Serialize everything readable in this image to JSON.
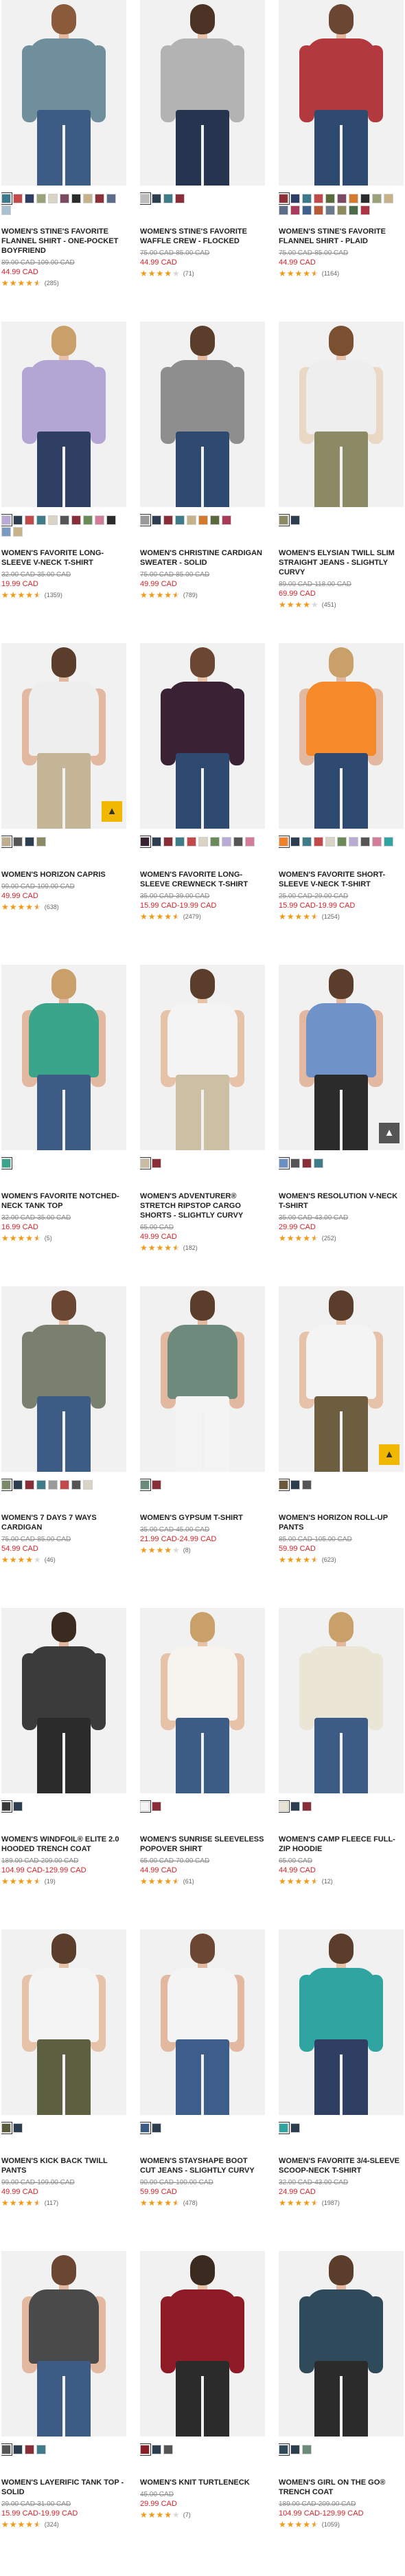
{
  "colors": {
    "sale_red": "#d5232a",
    "star_orange": "#f29b12",
    "strike_gray": "#8a8a8a",
    "badge_yellow": "#f2b800"
  },
  "products": [
    {
      "name": "Women's Stine's Favorite Flannel Shirt - One-Pocket Boyfriend",
      "price_original": "89.00 CAD-109.00 CAD",
      "price_sale": "44.99 CAD",
      "rating": 4.5,
      "reviews": "(285)",
      "swatches": [
        "#3b7a8c",
        "#c24a4a",
        "#2f3e63",
        "#9aa27a",
        "#d9d4c6",
        "#7a4b63",
        "#2b2b2b",
        "#c7b38a",
        "#8c2f39",
        "#5c6d8a",
        "#a9c1cf"
      ],
      "look": {
        "skin": "#e2b9a0",
        "hair": "#8a5a3a",
        "top": "#6f8f9c",
        "sleeve": "#6f8f9c",
        "legs": "#3c5b85"
      }
    },
    {
      "name": "Women's Stine's Favorite Waffle Crew - Flocked",
      "price_original": "75.00 CAD-85.00 CAD",
      "price_sale": "44.99 CAD",
      "rating": 4.0,
      "reviews": "(71)",
      "swatches": [
        "#bcbcbc",
        "#2c3e50",
        "#3f7c8a",
        "#8a2f3a"
      ],
      "look": {
        "skin": "#e6c2a8",
        "hair": "#4a3325",
        "top": "#b3b3b3",
        "sleeve": "#b3b3b3",
        "legs": "#26344f"
      }
    },
    {
      "name": "Women's Stine's Favorite Flannel Shirt - Plaid",
      "price_original": "75.00 CAD-85.00 CAD",
      "price_sale": "44.99 CAD",
      "rating": 4.5,
      "reviews": "(1164)",
      "swatches": [
        "#8c2f39",
        "#2f3e63",
        "#3b7a8c",
        "#c24a4a",
        "#5a6b3b",
        "#7a4b63",
        "#d47a2b",
        "#2b2b2b",
        "#9aa27a",
        "#c7b38a",
        "#5c6d8a",
        "#a83a5a",
        "#3f5f8f",
        "#b85a3a",
        "#6a7a8a",
        "#8a8a5a",
        "#4a6a4a",
        "#aa3344"
      ],
      "look": {
        "skin": "#e2b9a0",
        "hair": "#6b4632",
        "top": "#b23a3f",
        "sleeve": "#b23a3f",
        "legs": "#2f4a70"
      }
    },
    {
      "name": "Women's Favorite Long-Sleeve V-Neck T-Shirt",
      "price_original": "32.00 CAD-35.00 CAD",
      "price_sale": "19.99 CAD",
      "rating": 4.5,
      "reviews": "(1359)",
      "swatches": [
        "#b9aad6",
        "#2c3e50",
        "#c24a4a",
        "#3f7c8a",
        "#d9d4c6",
        "#555555",
        "#8a2f3a",
        "#6a8a5a",
        "#d47a9a",
        "#2b2b2b",
        "#7a9ac4",
        "#c7b38a"
      ],
      "look": {
        "skin": "#e6c2a8",
        "hair": "#c9a06a",
        "top": "#b3a6d4",
        "sleeve": "#b3a6d4",
        "legs": "#2f3e63"
      }
    },
    {
      "name": "Women's Christine Cardigan Sweater - Solid",
      "price_original": "75.00 CAD-85.00 CAD",
      "price_sale": "49.99 CAD",
      "rating": 4.5,
      "reviews": "(789)",
      "swatches": [
        "#9a9a9a",
        "#2c3e50",
        "#8a2f3a",
        "#3f7c8a",
        "#c7b38a",
        "#d47a2b",
        "#5a6b3b",
        "#a83a5a"
      ],
      "look": {
        "skin": "#e2b9a0",
        "hair": "#5a3d2a",
        "top": "#8e8e8e",
        "sleeve": "#8e8e8e",
        "legs": "#2f4a70"
      }
    },
    {
      "name": "Women's Elysian Twill Slim Straight Jeans - Slightly Curvy",
      "price_original": "89.00 CAD-118.00 CAD",
      "price_sale": "69.99 CAD",
      "rating": 4.0,
      "reviews": "(451)",
      "swatches": [
        "#8c8a64",
        "#2c3e50"
      ],
      "look": {
        "skin": "#e6c2a8",
        "hair": "#7a5030",
        "top": "#eeeeee",
        "sleeve": "#e8d8c4",
        "legs": "#8c8a64"
      }
    },
    {
      "name": "Women's Horizon Capris",
      "price_original": "99.00 CAD-109.00 CAD",
      "price_sale": "49.99 CAD",
      "rating": 4.5,
      "reviews": "(638)",
      "swatches": [
        "#bfae8e",
        "#555555",
        "#2c3e50",
        "#8c8a64"
      ],
      "look": {
        "skin": "#e2b9a0",
        "hair": "#5a3d2a",
        "top": "#eeeeee",
        "sleeve": "#e2b9a0",
        "legs": "#c4b596"
      }
    },
    {
      "name": "Women's Favorite Long-Sleeve Crewneck T-Shirt",
      "price_original": "35.00 CAD-39.00 CAD",
      "price_sale": "15.99 CAD-19.99 CAD",
      "rating": 4.5,
      "reviews": "(2479)",
      "swatches": [
        "#3a2235",
        "#2c3e50",
        "#8a2f3a",
        "#3f7c8a",
        "#c24a4a",
        "#d9d4c6",
        "#6a8a5a",
        "#b9aad6",
        "#555555",
        "#d47a9a"
      ],
      "look": {
        "skin": "#e6c2a8",
        "hair": "#6b4632",
        "top": "#3a2235",
        "sleeve": "#3a2235",
        "legs": "#2f4a70"
      }
    },
    {
      "name": "Women's Favorite Short-Sleeve V-Neck T-Shirt",
      "price_original": "25.00 CAD-29.00 CAD",
      "price_sale": "15.99 CAD-19.99 CAD",
      "rating": 4.5,
      "reviews": "(1254)",
      "swatches": [
        "#f2822a",
        "#2c3e50",
        "#3f7c8a",
        "#c24a4a",
        "#d9d4c6",
        "#6a8a5a",
        "#b9aad6",
        "#555555",
        "#d47a9a",
        "#2fa4a0"
      ],
      "look": {
        "skin": "#e2b9a0",
        "hair": "#c9a06a",
        "top": "#f68a2a",
        "sleeve": "#e2b9a0",
        "legs": "#2f4a70"
      }
    },
    {
      "name": "Women's Favorite Notched-Neck Tank Top",
      "price_original": "32.00 CAD-35.00 CAD",
      "price_sale": "16.99 CAD",
      "rating": 4.5,
      "reviews": "(5)",
      "swatches": [
        "#3aa58a"
      ],
      "look": {
        "skin": "#e2b9a0",
        "hair": "#c9a06a",
        "top": "#3aa58a",
        "sleeve": "#e2b9a0",
        "legs": "#3c5b85"
      }
    },
    {
      "name": "Women's Adventurer® Stretch Ripstop Cargo Shorts - Slightly Curvy",
      "price_original": "65.00 CAD",
      "price_sale": "49.99 CAD",
      "rating": 4.5,
      "reviews": "(182)",
      "swatches": [
        "#c9bca2",
        "#8a2f3a"
      ],
      "look": {
        "skin": "#e6c2a8",
        "hair": "#5a3d2a",
        "top": "#f4f4f4",
        "sleeve": "#e6c2a8",
        "legs": "#cdbfa4"
      }
    },
    {
      "name": "Women's Resolution V-Neck T-Shirt",
      "price_original": "35.00 CAD-43.00 CAD",
      "price_sale": "29.99 CAD",
      "rating": 4.5,
      "reviews": "(252)",
      "swatches": [
        "#6a8fc4",
        "#555555",
        "#8a2f3a",
        "#3f7c8a"
      ],
      "look": {
        "skin": "#e2b9a0",
        "hair": "#5a3d2a",
        "top": "#6f93c8",
        "sleeve": "#e2b9a0",
        "legs": "#2b2b2b"
      }
    },
    {
      "name": "Women's 7 Days 7 Ways Cardigan",
      "price_original": "75.00 CAD-85.00 CAD",
      "price_sale": "54.99 CAD",
      "rating": 4.0,
      "reviews": "(46)",
      "swatches": [
        "#7a8a6a",
        "#2c3e50",
        "#8a2f3a",
        "#3f7c8a",
        "#9a9a9a",
        "#c24a4a",
        "#555555",
        "#d9d4c6"
      ],
      "look": {
        "skin": "#e6c2a8",
        "hair": "#6b4632",
        "top": "#7a8070",
        "sleeve": "#7a8070",
        "legs": "#3c5b85"
      }
    },
    {
      "name": "Women's Gypsum T-Shirt",
      "price_original": "35.00 CAD-45.00 CAD",
      "price_sale": "21.99 CAD-24.99 CAD",
      "rating": 4.0,
      "reviews": "(8)",
      "swatches": [
        "#6a8a7a",
        "#8a2f3a"
      ],
      "look": {
        "skin": "#e2b9a0",
        "hair": "#5a3d2a",
        "top": "#6e8a7c",
        "sleeve": "#e2b9a0",
        "legs": "#f4f4f4"
      }
    },
    {
      "name": "Women's Horizon Roll-Up Pants",
      "price_original": "85.00 CAD-105.00 CAD",
      "price_sale": "59.99 CAD",
      "rating": 4.5,
      "reviews": "(623)",
      "swatches": [
        "#6a5a3a",
        "#2c3e50",
        "#555555"
      ],
      "look": {
        "skin": "#e6c2a8",
        "hair": "#5a3d2a",
        "top": "#f4f4f4",
        "sleeve": "#e6c2a8",
        "legs": "#6e5e40"
      }
    },
    {
      "name": "Women's WindFoil® Elite 2.0 Hooded Trench Coat",
      "price_original": "189.00 CAD-209.00 CAD",
      "price_sale": "104.99 CAD-129.99 CAD",
      "rating": 4.5,
      "reviews": "(19)",
      "swatches": [
        "#3a3a3a",
        "#2c3e50"
      ],
      "look": {
        "skin": "#e2b9a0",
        "hair": "#3a2a20",
        "top": "#3b3b3b",
        "sleeve": "#3b3b3b",
        "legs": "#2b2b2b"
      }
    },
    {
      "name": "Women's Sunrise Sleeveless Popover Shirt",
      "price_original": "65.00 CAD-70.00 CAD",
      "price_sale": "44.99 CAD",
      "rating": 4.5,
      "reviews": "(61)",
      "swatches": [
        "#f4f4f4",
        "#8a2f3a"
      ],
      "look": {
        "skin": "#e6c2a8",
        "hair": "#c9a06a",
        "top": "#f7f3ee",
        "sleeve": "#e6c2a8",
        "legs": "#3c5b85"
      }
    },
    {
      "name": "Women's Camp Fleece Full-Zip Hoodie",
      "price_original": "65.00 CAD",
      "price_sale": "44.99 CAD",
      "rating": 4.5,
      "reviews": "(12)",
      "swatches": [
        "#e8e2d2",
        "#2c3e50",
        "#8a2f3a"
      ],
      "look": {
        "skin": "#e2b9a0",
        "hair": "#c9a06a",
        "top": "#ebe5d6",
        "sleeve": "#ebe5d6",
        "legs": "#3c5b85"
      }
    },
    {
      "name": "Women's Kick Back Twill Pants",
      "price_original": "99.00 CAD-109.00 CAD",
      "price_sale": "49.99 CAD",
      "rating": 4.5,
      "reviews": "(117)",
      "swatches": [
        "#5a5e3a",
        "#2c3e50"
      ],
      "look": {
        "skin": "#e6c2a8",
        "hair": "#5a3d2a",
        "top": "#f4f4f4",
        "sleeve": "#e6c2a8",
        "legs": "#5c6040"
      }
    },
    {
      "name": "Women's StayShape Boot Cut Jeans - Slightly Curvy",
      "price_original": "90.00 CAD-100.00 CAD",
      "price_sale": "59.99 CAD",
      "rating": 4.5,
      "reviews": "(478)",
      "swatches": [
        "#3c5b85",
        "#2c3e50"
      ],
      "look": {
        "skin": "#e2b9a0",
        "hair": "#6b4632",
        "top": "#f4f4f4",
        "sleeve": "#e2b9a0",
        "legs": "#3d5e8a"
      }
    },
    {
      "name": "Women's Favorite 3/4-Sleeve Scoop-Neck T-Shirt",
      "price_original": "32.00 CAD-43.00 CAD",
      "price_sale": "24.99 CAD",
      "rating": 4.5,
      "reviews": "(1987)",
      "swatches": [
        "#2fa4a0",
        "#2c3e50"
      ],
      "look": {
        "skin": "#e6c2a8",
        "hair": "#5a3d2a",
        "top": "#2fa4a0",
        "sleeve": "#2fa4a0",
        "legs": "#2f3e63"
      }
    },
    {
      "name": "Women's Layerific Tank Top - Solid",
      "price_original": "29.00 CAD-31.00 CAD",
      "price_sale": "15.99 CAD-19.99 CAD",
      "rating": 4.5,
      "reviews": "(324)",
      "swatches": [
        "#555555",
        "#2c3e50",
        "#8a2f3a",
        "#3f7c8a"
      ],
      "look": {
        "skin": "#e2b9a0",
        "hair": "#6b4632",
        "top": "#4a4a4a",
        "sleeve": "#e2b9a0",
        "legs": "#3c5b85"
      }
    },
    {
      "name": "Women's Knit Turtleneck",
      "price_original": "45.00 CAD",
      "price_sale": "29.99 CAD",
      "rating": 4.0,
      "reviews": "(7)",
      "swatches": [
        "#8a1f2a",
        "#2c3e50",
        "#555555"
      ],
      "look": {
        "skin": "#e6c2a8",
        "hair": "#3a2a20",
        "top": "#8e1b26",
        "sleeve": "#8e1b26",
        "legs": "#2b2b2b"
      }
    },
    {
      "name": "Women's Girl On The Go® Trench Coat",
      "price_original": "189.00 CAD-209.00 CAD",
      "price_sale": "104.99 CAD-129.99 CAD",
      "rating": 4.5,
      "reviews": "(1059)",
      "swatches": [
        "#2f4a5a",
        "#2c3e50",
        "#6a8a7a"
      ],
      "look": {
        "skin": "#e2b9a0",
        "hair": "#5a3d2a",
        "top": "#2f4a5a",
        "sleeve": "#2f4a5a",
        "legs": "#2b2b2b"
      }
    }
  ]
}
